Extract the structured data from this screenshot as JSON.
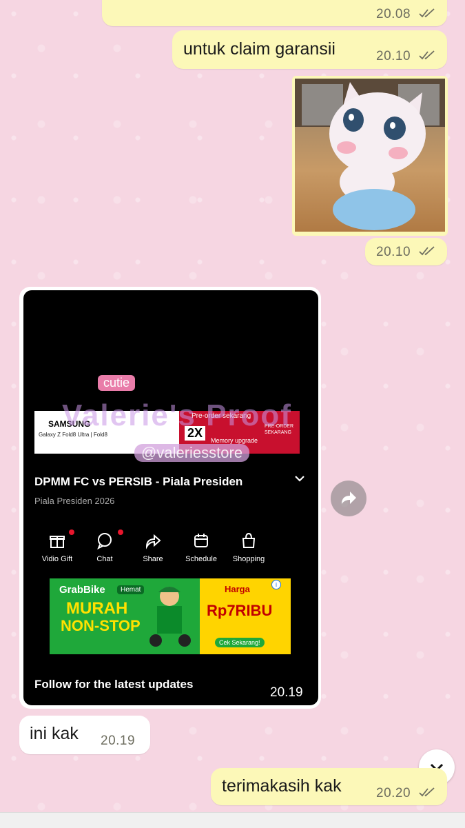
{
  "messages": [
    {
      "id": "m1",
      "text": "",
      "time": "20.08"
    },
    {
      "id": "m2",
      "text": "untuk claim garansii",
      "time": "20.10"
    },
    {
      "id": "m3",
      "image": "talking-angela-sticker",
      "time": "20.10"
    },
    {
      "id": "m4",
      "text": "",
      "time": "20.19"
    },
    {
      "id": "m5",
      "text": "ini kak",
      "time": "20.19"
    },
    {
      "id": "m6",
      "text": "terimakasih kak",
      "time": "20.20"
    }
  ],
  "shared_screenshot": {
    "video_title": "DPMM FC vs PERSIB - Piala Presiden",
    "video_subtitle": "Piala Presiden 2026",
    "actions": [
      {
        "label": "Vidio Gift",
        "icon": "gift-icon",
        "badge": true
      },
      {
        "label": "Chat",
        "icon": "chat-icon",
        "badge": true
      },
      {
        "label": "Share",
        "icon": "share-icon",
        "badge": false
      },
      {
        "label": "Schedule",
        "icon": "calendar-icon",
        "badge": false
      },
      {
        "label": "Shopping",
        "icon": "shopping-bag-icon",
        "badge": false
      }
    ],
    "banner": {
      "brand": "SAMSUNG",
      "model": "Galaxy Z Fold8 Ultra | Fold8",
      "preorder": "Pre-order sekarang",
      "promo": "2X",
      "promo_sub": "Memory upgrade",
      "cta": "PRE-ORDER SEKARANG"
    },
    "ad": {
      "brand": "GrabBike",
      "tag": "Hemat",
      "headline1": "MURAH",
      "headline2": "NON-STOP",
      "price_label": "Harga",
      "price": "Rp7RIBU",
      "cta": "Cek Sekarang!"
    },
    "follow_text": "Follow for the latest updates"
  },
  "watermark": {
    "cutie": "cutie",
    "title": "Valerie's Proof",
    "handle": "@valeriesstore"
  },
  "colors": {
    "outgoing": "#fcf8b8",
    "incoming": "#ffffff",
    "background": "#f6d6e2"
  }
}
